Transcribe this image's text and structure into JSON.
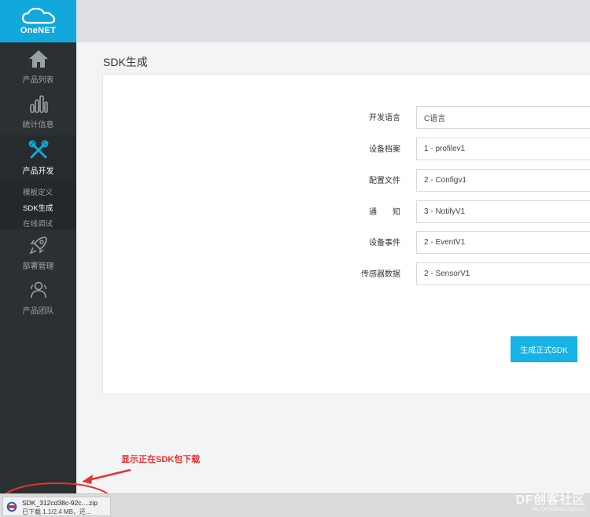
{
  "logo": {
    "text": "OneNET"
  },
  "sidebar": {
    "items": [
      {
        "label": "产品列表",
        "icon": "home-icon"
      },
      {
        "label": "统计信息",
        "icon": "bar-chart-icon"
      },
      {
        "label": "产品开发",
        "icon": "tools-icon"
      },
      {
        "label": "部署管理",
        "icon": "rocket-icon"
      },
      {
        "label": "产品团队",
        "icon": "team-icon"
      }
    ],
    "submenu": [
      {
        "label": "模板定义"
      },
      {
        "label": "SDK生成"
      },
      {
        "label": "在线调试"
      }
    ]
  },
  "page": {
    "title": "SDK生成"
  },
  "form": {
    "fields": [
      {
        "label": "开发语言",
        "value": "C语言"
      },
      {
        "label": "设备档案",
        "value": "1 - profilev1"
      },
      {
        "label": "配置文件",
        "value": "2 - Configv1"
      },
      {
        "label": "通　　知",
        "value": "3 - NotifyV1"
      },
      {
        "label": "设备事件",
        "value": "2 - EventV1"
      },
      {
        "label": "传感器数据",
        "value": "2 - SensorV1"
      }
    ],
    "generate_label": "生成正式SDK"
  },
  "annotation": {
    "text": "显示正在SDK包下载"
  },
  "download": {
    "file_name": "SDK_312cd38c-92c....zip",
    "status": "已下载 1.1/2.4 MB，还..."
  },
  "watermark": {
    "text": "DF创客社区",
    "url": "mc.DFRobot.com.cn"
  },
  "colors": {
    "accent": "#17b2e6",
    "sidebar": "#2b3033",
    "annotation": "#e8312f"
  }
}
